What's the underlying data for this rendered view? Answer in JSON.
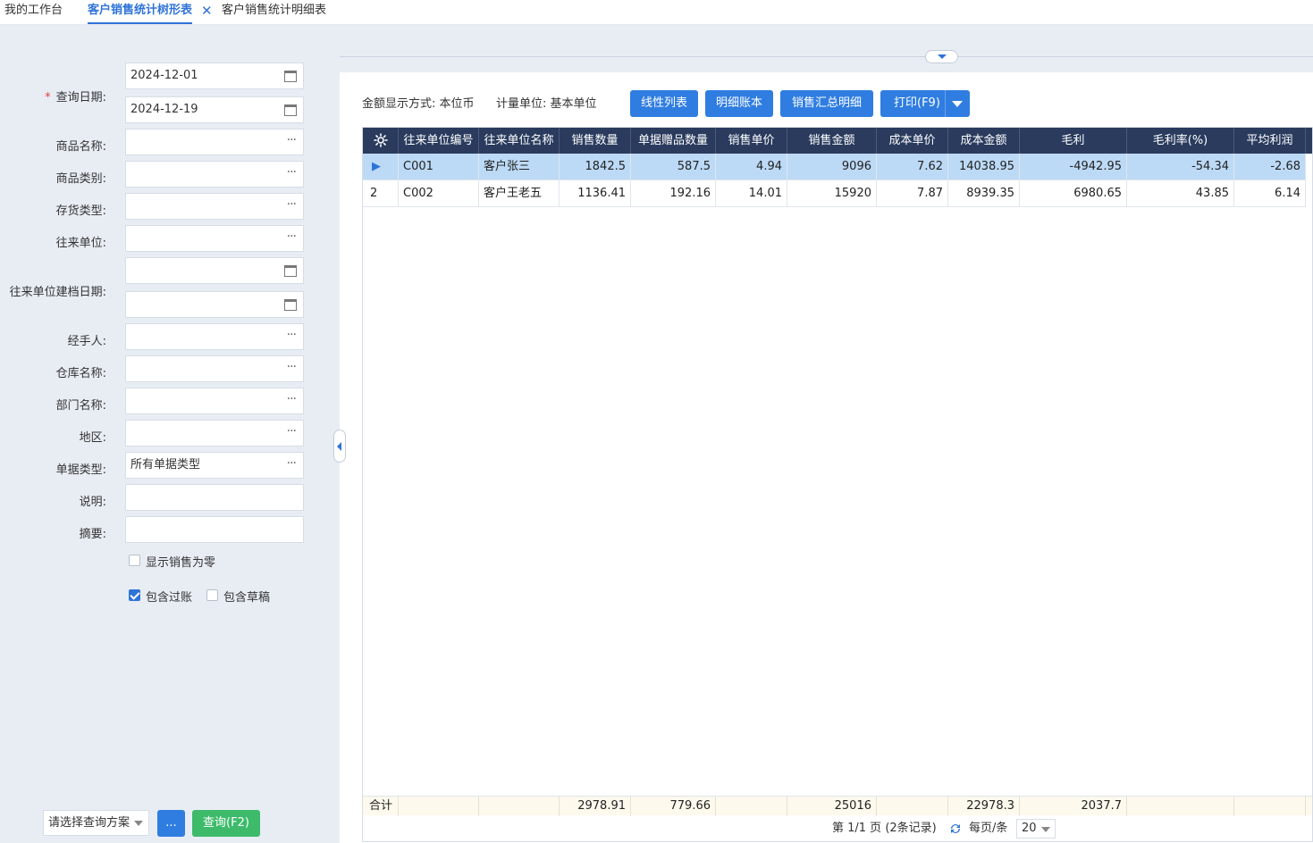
{
  "tabs": [
    {
      "label": "我的工作台",
      "active": false
    },
    {
      "label": "客户销售统计树形表",
      "active": true,
      "closable": true
    },
    {
      "label": "客户销售统计明细表",
      "active": false
    }
  ],
  "filters": {
    "date_label": "查询日期:",
    "date_from": "2024-12-01",
    "date_to": "2024-12-19",
    "product_name_label": "商品名称:",
    "product_category_label": "商品类别:",
    "stock_type_label": "存货类型:",
    "partner_label": "往来单位:",
    "partner_created_label": "往来单位建档日期:",
    "handler_label": "经手人:",
    "warehouse_label": "仓库名称:",
    "department_label": "部门名称:",
    "region_label": "地区:",
    "doc_type_label": "单据类型:",
    "doc_type_value": "所有单据类型",
    "note_label": "说明:",
    "summary_label": "摘要:",
    "show_zero_label": "显示销售为零",
    "show_zero_checked": false,
    "include_posted_label": "包含过账",
    "include_posted_checked": true,
    "include_draft_label": "包含草稿",
    "include_draft_checked": false
  },
  "footer": {
    "scheme_placeholder": "请选择查询方案",
    "more_label": "...",
    "query_label": "查询(F2)"
  },
  "toolbar": {
    "amount_display": "金额显示方式: 本位币",
    "unit_display": "计量单位: 基本单位",
    "linear_list": "线性列表",
    "detail_ledger": "明细账本",
    "sales_summary_detail": "销售汇总明细",
    "print": "打印(F9)"
  },
  "table": {
    "columns": [
      "往来单位编号",
      "往来单位名称",
      "销售数量",
      "单据赠品数量",
      "销售单价",
      "销售金额",
      "成本单价",
      "成本金额",
      "毛利",
      "毛利率(%)",
      "平均利润"
    ],
    "rows": [
      {
        "idx": "",
        "selected": true,
        "cells": [
          "C001",
          "客户张三",
          "1842.5",
          "587.5",
          "4.94",
          "9096",
          "7.62",
          "14038.95",
          "-4942.95",
          "-54.34",
          "-2.68"
        ]
      },
      {
        "idx": "2",
        "selected": false,
        "cells": [
          "C002",
          "客户王老五",
          "1136.41",
          "192.16",
          "14.01",
          "15920",
          "7.87",
          "8939.35",
          "6980.65",
          "43.85",
          "6.14"
        ]
      }
    ],
    "totals": {
      "label": "合计",
      "cells": [
        "",
        "",
        "2978.91",
        "779.66",
        "",
        "25016",
        "",
        "22978.3",
        "2037.7",
        "",
        ""
      ]
    }
  },
  "pagination": {
    "page_info": "第 1/1 页 (2条记录)",
    "per_page_label": "每页/条",
    "page_size": "20"
  },
  "colors": {
    "accent": "#2f73d8",
    "header_bg": "#2a3b5e",
    "selected_row": "#bcdaf6",
    "query_button": "#3dbb6b"
  }
}
